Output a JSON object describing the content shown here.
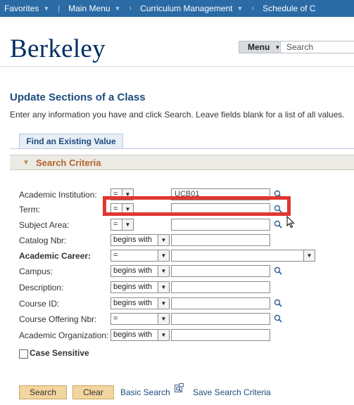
{
  "topnav": {
    "items": [
      "Favorites",
      "Main Menu",
      "Curriculum Management",
      "Schedule of C"
    ]
  },
  "banner": {
    "logo": "Berkeley",
    "menu_label": "Menu",
    "search_placeholder": "Search"
  },
  "page": {
    "title": "Update Sections of a Class",
    "instructions": "Enter any information you have and click Search. Leave fields blank for a list of all values.",
    "tab": "Find an Existing Value",
    "criteria_header": "Search Criteria"
  },
  "fields": [
    {
      "label": "Academic Institution:",
      "operator": "=",
      "value": "UCB01",
      "lookup": true
    },
    {
      "label": "Term:",
      "operator": "=",
      "value": "",
      "lookup": true
    },
    {
      "label": "Subject Area:",
      "operator": "=",
      "value": "",
      "lookup": true
    },
    {
      "label": "Catalog Nbr:",
      "operator": "begins with",
      "value": "",
      "lookup": false
    },
    {
      "label": "Academic Career:",
      "operator": "=",
      "value": "",
      "lookup": false
    },
    {
      "label": "Campus:",
      "operator": "begins with",
      "value": "",
      "lookup": true
    },
    {
      "label": "Description:",
      "operator": "begins with",
      "value": "",
      "lookup": false
    },
    {
      "label": "Course ID:",
      "operator": "begins with",
      "value": "",
      "lookup": true
    },
    {
      "label": "Course Offering Nbr:",
      "operator": "=",
      "value": "",
      "lookup": true
    },
    {
      "label": "Academic Organization:",
      "operator": "begins with",
      "value": "",
      "lookup": false
    }
  ],
  "case_sensitive": {
    "label": "Case Sensitive",
    "checked": false
  },
  "actions": {
    "search": "Search",
    "clear": "Clear",
    "basic_search": "Basic Search",
    "save_search": "Save Search Criteria"
  },
  "colors": {
    "nav_bg": "#2a6aa5",
    "title": "#1c4b7e",
    "criteria_text": "#b4632c",
    "button_bg": "#f3d59f",
    "highlight": "#e0372f"
  }
}
